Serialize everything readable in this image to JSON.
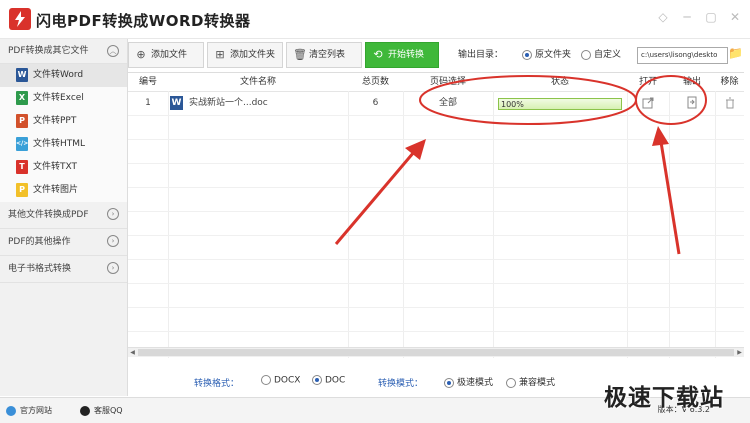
{
  "app": {
    "title": "闪电PDF转换成WORD转换器"
  },
  "window_controls": [
    {
      "name": "tshirt-skin-icon",
      "glyph": "◇"
    },
    {
      "name": "minimize-icon",
      "glyph": "─"
    },
    {
      "name": "maximize-icon",
      "glyph": "▢"
    },
    {
      "name": "close-icon",
      "glyph": "✕"
    }
  ],
  "sidebar": {
    "sections": [
      {
        "label": "PDF转换成其它文件",
        "expanded": true
      },
      {
        "label": "其他文件转换成PDF"
      },
      {
        "label": "PDF的其他操作"
      },
      {
        "label": "电子书格式转换"
      }
    ],
    "items": [
      {
        "label": "文件转Word",
        "icon_letter": "W",
        "icon_color": "#2b5797",
        "active": true
      },
      {
        "label": "文件转Excel",
        "icon_letter": "X",
        "icon_color": "#2e9a4c"
      },
      {
        "label": "文件转PPT",
        "icon_letter": "P",
        "icon_color": "#d2512b"
      },
      {
        "label": "文件转HTML",
        "icon_letter": "</>",
        "icon_color": "#3aa0d8"
      },
      {
        "label": "文件转TXT",
        "icon_letter": "T",
        "icon_color": "#d9322b"
      },
      {
        "label": "文件转图片",
        "icon_letter": "P",
        "icon_color": "#f2c029"
      }
    ]
  },
  "toolbar": {
    "add_file": "添加文件",
    "add_folder": "添加文件夹",
    "clear_list": "清空列表",
    "start": "开始转换",
    "output_dir_label": "输出目录：",
    "opt_source": "原文件夹",
    "opt_custom": "自定义",
    "path": "c:\\users\\lisong\\deskto"
  },
  "table": {
    "headers": [
      "编号",
      "文件名称",
      "总页数",
      "页码选择",
      "状态",
      "打开",
      "输出",
      "移除"
    ],
    "rows": [
      {
        "index": "1",
        "name": "实战新站一个...doc",
        "pages": "6",
        "page_select": "全部",
        "status": "100%",
        "progress": 1.0
      }
    ]
  },
  "bottom": {
    "format_label": "转换格式：",
    "fmt_docx": "DOCX",
    "fmt_doc": "DOC",
    "mode_label": "转换模式：",
    "mode_fast": "极速模式",
    "mode_compat": "兼容模式"
  },
  "status": {
    "website": "官方网站",
    "support": "客服QQ",
    "version": "版本：V 6.3.2"
  },
  "watermark": "极速下载站",
  "colors": {
    "accent_green": "#3fb83a",
    "annotation_red": "#d9332b",
    "link_blue": "#2b5fb3"
  }
}
